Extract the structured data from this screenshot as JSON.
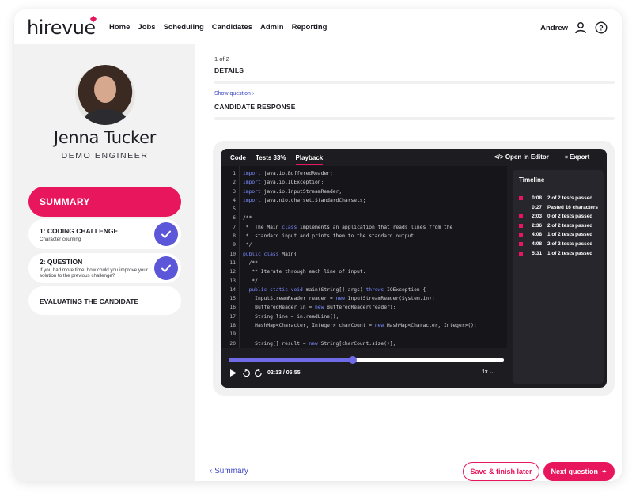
{
  "brand": {
    "logo": "hirevue",
    "accent": "#e8165c",
    "link": "#3b45c4",
    "check": "#5b57d8"
  },
  "nav": {
    "items": [
      "Home",
      "Jobs",
      "Scheduling",
      "Candidates",
      "Admin",
      "Reporting"
    ],
    "user": "Andrew"
  },
  "candidate": {
    "name": "Jenna Tucker",
    "title": "DEMO ENGINEER"
  },
  "sidebar": {
    "summary": "SUMMARY",
    "steps": [
      {
        "title": "1: CODING CHALLENGE",
        "sub": "Character counting",
        "done": true
      },
      {
        "title": "2: QUESTION",
        "sub": "If you had more time, how could you improve your solution to the previous challenge?",
        "done": true
      },
      {
        "title": "EVALUATING THE CANDIDATE",
        "sub": "",
        "done": false
      }
    ]
  },
  "main": {
    "count": "1 of 2",
    "details": "DETAILS",
    "show_question": "Show question",
    "candidate_response": "CANDIDATE RESPONSE"
  },
  "player": {
    "tabs": [
      "Code",
      "Tests 33%",
      "Playback"
    ],
    "open_editor": "Open in Editor",
    "export": "Export",
    "code": [
      "import java.io.BufferedReader;",
      "import java.io.IOException;",
      "import java.io.InputStreamReader;",
      "import java.nio.charset.StandardCharsets;",
      "",
      "/**",
      " *  The Main class implements an application that reads lines from the",
      " *  standard input and prints them to the standard output",
      " */",
      "public class Main{",
      "  /**",
      "   ** Iterate through each line of input.",
      "   */",
      "  public static void main(String[] args) throws IOException {",
      "    InputStreamReader reader = new InputStreamReader(System.in);",
      "    BufferedReader in = new BufferedReader(reader);",
      "    String line = in.readLine();",
      "    HashMap<Character, Integer> charCount = new HashMap<Character, Integer>();",
      "",
      "    String[] result = new String[charCount.size()];"
    ],
    "timeline_title": "Timeline",
    "timeline": [
      {
        "time": "0:08",
        "text": "2 of 2 tests passed",
        "dot": true
      },
      {
        "time": "0:27",
        "text": "Pasted 16 characters",
        "dot": false
      },
      {
        "time": "2:03",
        "text": "0 of 2 tests passed",
        "dot": true
      },
      {
        "time": "2:36",
        "text": "2 of 2 tests passed",
        "dot": true
      },
      {
        "time": "4:08",
        "text": "1 of 2 tests passed",
        "dot": true
      },
      {
        "time": "4:08",
        "text": "2 of 2 tests passed",
        "dot": true
      },
      {
        "time": "5:31",
        "text": "1 of 2 tests passed",
        "dot": true
      }
    ],
    "time_readout": "02:13 / 05:55",
    "progress_fraction": 0.45,
    "speed": "1x"
  },
  "footer": {
    "back": "Summary",
    "save": "Save & finish later",
    "next": "Next question"
  }
}
